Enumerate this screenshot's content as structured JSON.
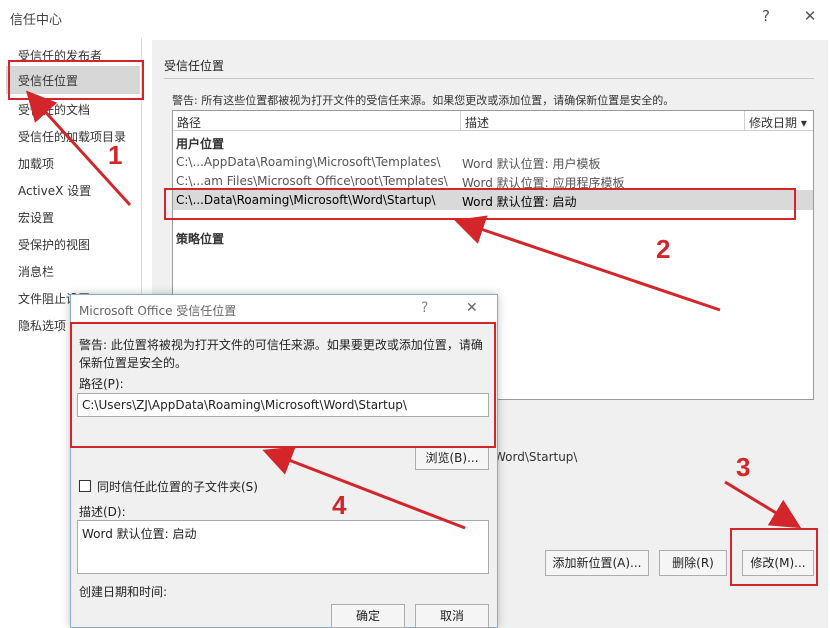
{
  "window": {
    "title": "信任中心",
    "help": "?",
    "close": "✕"
  },
  "sidebar": {
    "items": [
      {
        "label": "受信任的发布者"
      },
      {
        "label": "受信任位置"
      },
      {
        "label": "受信任的文档"
      },
      {
        "label": "受信任的加载项目录"
      },
      {
        "label": "加载项"
      },
      {
        "label": "ActiveX 设置"
      },
      {
        "label": "宏设置"
      },
      {
        "label": "受保护的视图"
      },
      {
        "label": "消息栏"
      },
      {
        "label": "文件阻止设置"
      },
      {
        "label": "隐私选项"
      }
    ]
  },
  "main": {
    "section_title": "受信任位置",
    "warning": "警告: 所有这些位置都被视为打开文件的受信任来源。如果您更改或添加位置，请确保新位置是安全的。",
    "columns": [
      "路径",
      "描述",
      "修改日期 ▾"
    ],
    "user_group": "用户位置",
    "policy_group": "策略位置",
    "rows": [
      {
        "path": "C:\\...AppData\\Roaming\\Microsoft\\Templates\\",
        "desc": "Word 默认位置: 用户模板"
      },
      {
        "path": "C:\\...am Files\\Microsoft Office\\root\\Templates\\",
        "desc": "Word 默认位置: 应用程序模板"
      },
      {
        "path": "C:\\...Data\\Roaming\\Microsoft\\Word\\Startup\\",
        "desc": "Word 默认位置: 启动"
      }
    ],
    "detail_path_tail": "Word\\Startup\\",
    "buttons": {
      "add": "添加新位置(A)...",
      "remove": "删除(R)",
      "modify": "修改(M)..."
    }
  },
  "dialog": {
    "title": "Microsoft Office 受信任位置",
    "help": "?",
    "close": "✕",
    "warning_line1": "警告: 此位置将被视为打开文件的可信任来源。如果要更改或添加位置，请确",
    "warning_line2": "保新位置是安全的。",
    "path_label": "路径(P):",
    "path_value": "C:\\Users\\ZJ\\AppData\\Roaming\\Microsoft\\Word\\Startup\\",
    "browse": "浏览(B)...",
    "subfolders_label": "同时信任此位置的子文件夹(S)",
    "desc_label": "描述(D):",
    "desc_value": "Word 默认位置: 启动",
    "created_label": "创建日期和时间:",
    "ok": "确定",
    "cancel": "取消"
  },
  "annotations": {
    "n1": "1",
    "n2": "2",
    "n3": "3",
    "n4": "4",
    "color": "#d4252b"
  }
}
